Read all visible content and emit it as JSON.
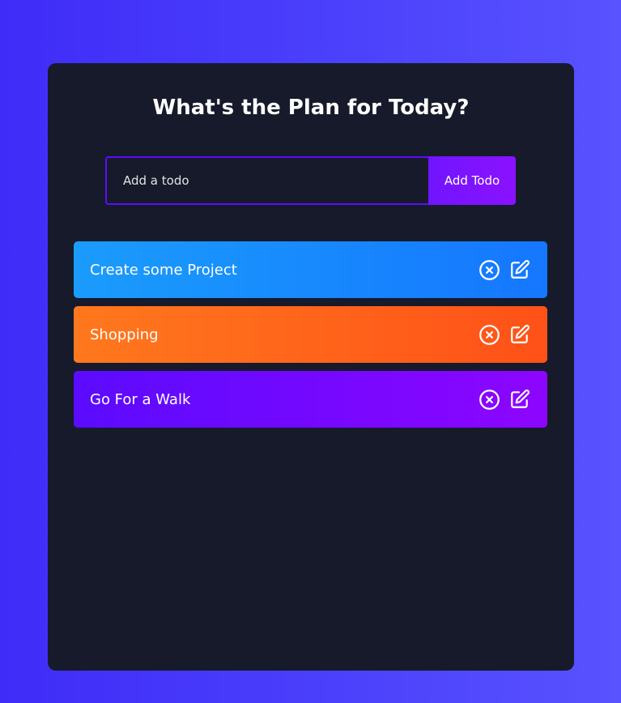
{
  "app": {
    "title": "What's the Plan for Today?"
  },
  "form": {
    "input_placeholder": "Add a todo",
    "input_value": "",
    "button_label": "Add Todo"
  },
  "todos": [
    {
      "text": "Create some Project",
      "color": "blue"
    },
    {
      "text": "Shopping",
      "color": "orange"
    },
    {
      "text": "Go For a Walk",
      "color": "purple"
    }
  ],
  "icons": {
    "delete": "close-circle-icon",
    "edit": "edit-icon"
  },
  "colors": {
    "background_gradient": [
      "#3f2cf8",
      "#5852ff"
    ],
    "panel": "#161a2b",
    "accent": "#5d0cff",
    "button": "#7d12ff",
    "todo_blue": "#1577ff",
    "todo_orange": "#ff5118",
    "todo_purple": "#8d05ff"
  }
}
